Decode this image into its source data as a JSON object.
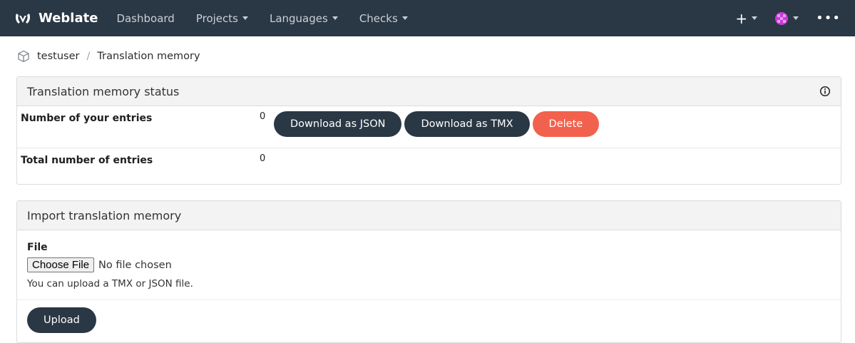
{
  "nav": {
    "brand": "Weblate",
    "links": [
      "Dashboard",
      "Projects",
      "Languages",
      "Checks"
    ],
    "add_icon": "plus-icon",
    "avatar_icon": "user-avatar-icon",
    "more_icon": "ellipsis-icon"
  },
  "breadcrumb": {
    "user": "testuser",
    "separator": "/",
    "page": "Translation memory"
  },
  "status_panel": {
    "title": "Translation memory status",
    "rows": [
      {
        "label": "Number of your entries",
        "value": "0"
      },
      {
        "label": "Total number of entries",
        "value": "0"
      }
    ],
    "buttons": {
      "download_json": "Download as JSON",
      "download_tmx": "Download as TMX",
      "delete": "Delete"
    }
  },
  "import_panel": {
    "title": "Import translation memory",
    "file_label": "File",
    "choose_button": "Choose File",
    "no_file": "No file chosen",
    "help": "You can upload a TMX or JSON file.",
    "upload_button": "Upload"
  },
  "colors": {
    "navbar": "#2a3744",
    "button_dark": "#2a3744",
    "button_danger": "#f2614d"
  }
}
